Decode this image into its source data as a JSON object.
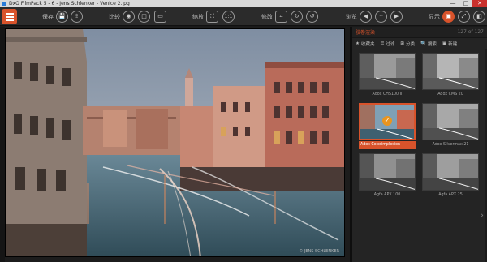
{
  "window": {
    "title": "DxO FilmPack 5 - 6 - Jens Schlenker - Venice 2.jpg",
    "minimize": "—",
    "maximize": "□",
    "close": "✕"
  },
  "toolbar": {
    "save_label": "保存",
    "compare_label": "比较",
    "zoom_label": "缩放",
    "zoom_value": "1:1",
    "edit_label": "修改",
    "browse_label": "浏览",
    "display_label": "显示"
  },
  "panel": {
    "category": "胶卷渲染",
    "count": "127 of 127",
    "filters": [
      {
        "icon": "★",
        "label": "收藏夹"
      },
      {
        "icon": "☰",
        "label": "过滤"
      },
      {
        "icon": "⊞",
        "label": "分类"
      },
      {
        "icon": "🔍",
        "label": "搜索"
      },
      {
        "icon": "▣",
        "label": "新建"
      }
    ],
    "thumbnails": [
      {
        "caption": "Adox CHS100 II",
        "selected": false
      },
      {
        "caption": "Adox CMS 20",
        "selected": false
      },
      {
        "caption": "Adox Colorimplosion",
        "selected": true
      },
      {
        "caption": "Adox Silvermax 21",
        "selected": false
      },
      {
        "caption": "Agfa APX 100",
        "selected": false
      },
      {
        "caption": "Agfa APX 25",
        "selected": false
      }
    ]
  },
  "photo": {
    "watermark": "© JENS SCHLENKER"
  },
  "colors": {
    "accent": "#d8532b",
    "toolbar_bg": "#2b2b2b",
    "panel_bg": "#242424"
  }
}
